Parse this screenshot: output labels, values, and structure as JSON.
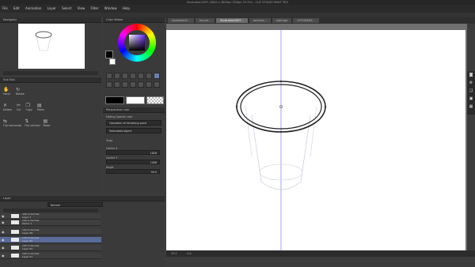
{
  "window": {
    "title": "Illustration2097 (3840 x 3840px 350dpi 33.3%) - CLIP STUDIO PAINT PRO"
  },
  "menu": [
    "File",
    "Edit",
    "Animation",
    "Layer",
    "Select",
    "View",
    "Filter",
    "Window",
    "Help"
  ],
  "panels": {
    "navigator": {
      "title": "Navigator"
    },
    "color_wheel": {
      "title": "Color Wheel"
    },
    "subtool": {
      "title": "Sub Tool",
      "tool_labels": [
        "Hand",
        "Rotate"
      ]
    },
    "edit_tools": {
      "row1": [
        "Delete",
        "Cut",
        "Copy",
        "Paste"
      ],
      "row2": [
        "Flip horizontal",
        "Flip vertical",
        "Paste"
      ]
    },
    "tool_property": {
      "title": "Perspective ruler",
      "editing_label": "Editing Special ruler",
      "dropdown1": "Operation of Vanishing point",
      "dropdown2": "Selectable object",
      "snap_label": "Snap",
      "center_x_label": "Center X",
      "center_x_value": "1826",
      "center_y_label": "Center Y",
      "center_y_value": "1006",
      "angle_label": "Angle",
      "angle_value": "90.0"
    },
    "layer": {
      "title": "Layer",
      "blend": "Normal",
      "rows": [
        {
          "line1": "100 % Normal",
          "line2": "Layer 2",
          "selected": false
        },
        {
          "line1": "100 % Normal",
          "line2": "Vector 1",
          "selected": false
        },
        {
          "line1": "100 % Normal",
          "line2": "Layer 68",
          "selected": false
        },
        {
          "line1": "100 % Normal",
          "line2": "Layer 83",
          "selected": true
        },
        {
          "line1": "100 % Normal",
          "line2": "Layer 62",
          "selected": false
        },
        {
          "line1": "100 % Normal",
          "line2": "Layer 67",
          "selected": false
        }
      ]
    }
  },
  "tabs": [
    "Illustration2...",
    "bus-prl...",
    "Illustration2097...",
    "cactrous...",
    "rubis.tga",
    "OUTLINE&S..."
  ],
  "active_tab": 2,
  "status": {
    "zoom": "33.3",
    "angle": "0.0"
  },
  "colors": {
    "accent": "#5a6a9a",
    "ruler": "#8888ff"
  }
}
